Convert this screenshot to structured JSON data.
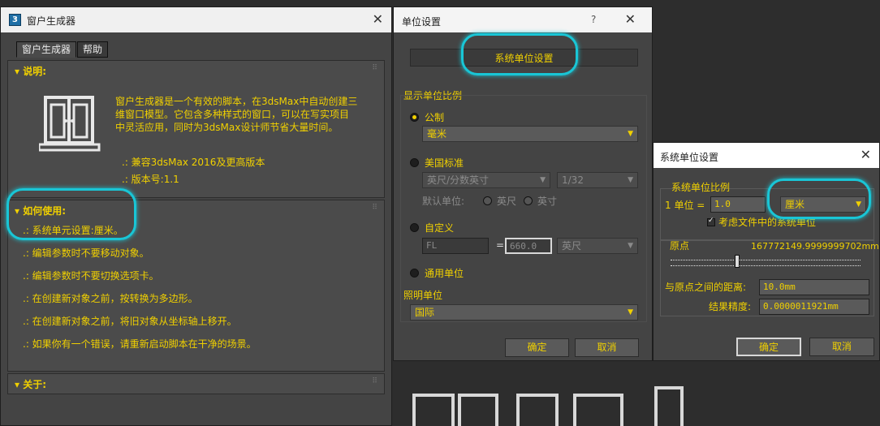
{
  "generator": {
    "title": "窗户生成器",
    "app_icon_text": "3",
    "tabs": [
      "窗户生成器",
      "帮助"
    ],
    "about_section": {
      "title": "说明:",
      "description_lines": [
        "窗户生成器是一个有效的脚本，在3dsMax中自动创建三",
        "维窗口模型。它包含多种样式的窗口，可以在写实项目",
        "中灵活应用，同时为3dsMax设计师节省大量时间。"
      ],
      "compat": ".: 兼容3dsMax 2016及更高版本",
      "version": ".: 版本号:1.1"
    },
    "howto_section": {
      "title": "如何使用:",
      "items": [
        ".: 系统单元设置:厘米。",
        ".: 编辑参数时不要移动对象。",
        ".: 编辑参数时不要切换选项卡。",
        ".: 在创建新对象之前，按转换为多边形。",
        ".: 在创建新对象之前，将旧对象从坐标轴上移开。",
        ".: 如果你有一个错误，请重新启动脚本在干净的场景。"
      ]
    },
    "about2_title": "关于:"
  },
  "unit_setup": {
    "title": "单位设置",
    "help": "?",
    "system_unit_button": "系统单位设置",
    "display_scale_label": "显示单位比例",
    "metric_label": "公制",
    "metric_value": "毫米",
    "us_label": "美国标准",
    "us_unit_value": "英尺/分数英寸",
    "us_fraction_value": "1/32",
    "default_unit_label": "默认单位:",
    "default_feet": "英尺",
    "default_inch": "英寸",
    "custom_label": "自定义",
    "custom_name": "FL",
    "custom_equals": "=",
    "custom_value": "660.0",
    "custom_unit": "英尺",
    "generic_label": "通用单位",
    "lighting_label": "照明单位",
    "lighting_value": "国际",
    "ok": "确定",
    "cancel": "取消"
  },
  "system_unit": {
    "title": "系统单位设置",
    "scale_label": "系统单位比例",
    "unit_prefix": "1 单位 =",
    "unit_value": "1.0",
    "unit_dropdown": "厘米",
    "consider_files": "考虑文件中的系统单位",
    "origin_label": "原点",
    "origin_value": "167772149.9999999702mm",
    "distance_label": "与原点之间的距离:",
    "distance_value": "10.0mm",
    "precision_label": "结果精度:",
    "precision_value": "0.0000011921mm",
    "ok": "确定",
    "cancel": "取消"
  },
  "colors": {
    "accent_yellow": "#f0d000",
    "highlight_cyan": "#19c6d6",
    "panel_bg": "#444444"
  }
}
